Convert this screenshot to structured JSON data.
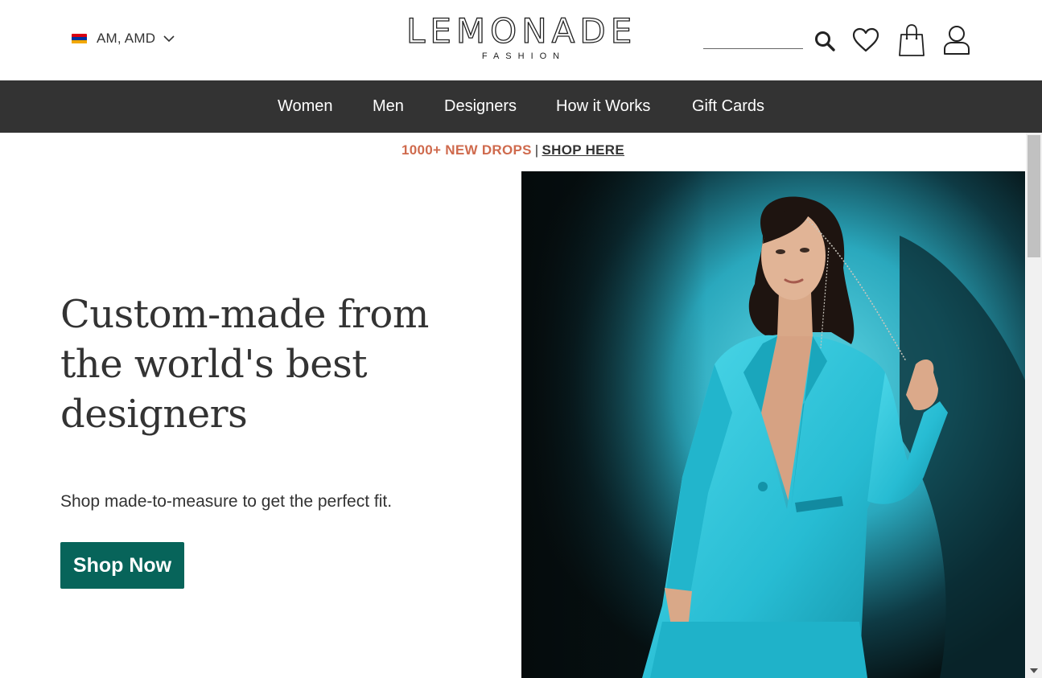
{
  "header": {
    "locale": {
      "label": "AM, AMD",
      "flag_colors": [
        "#d90012",
        "#0033a0",
        "#f2a800"
      ]
    },
    "logo": {
      "word": "LEMONADE",
      "sub": "FASHION"
    },
    "search": {
      "value": "",
      "placeholder": ""
    },
    "icons": [
      "search-icon",
      "heart-icon",
      "shopping-bag-icon",
      "user-icon"
    ]
  },
  "nav": {
    "items": [
      {
        "label": "Women"
      },
      {
        "label": "Men"
      },
      {
        "label": "Designers"
      },
      {
        "label": "How it Works"
      },
      {
        "label": "Gift Cards"
      }
    ]
  },
  "promo": {
    "highlight": "1000+ NEW DROPS",
    "separator": "|",
    "link_label": "SHOP HERE",
    "highlight_color": "#cf6a4d"
  },
  "hero": {
    "title": "Custom-made from the world's best designers",
    "subtitle": "Shop made-to-measure to get the perfect fit.",
    "cta_label": "Shop Now",
    "cta_color": "#07645a"
  },
  "colors": {
    "nav_background": "#333333",
    "text": "#333333",
    "suit_accent": "#35c8dc"
  }
}
